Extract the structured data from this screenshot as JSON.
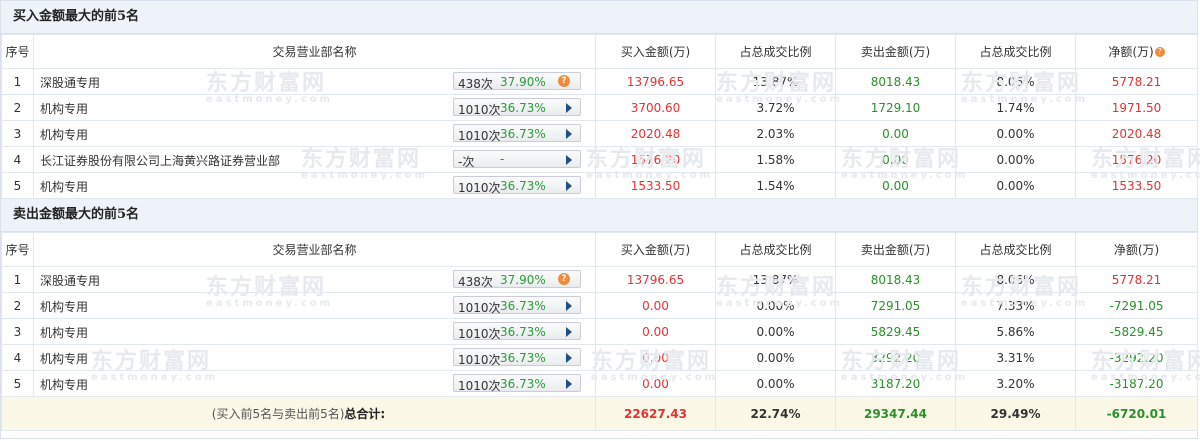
{
  "watermark": {
    "cn": "东方财富网",
    "en": "eastmoney.com"
  },
  "buy_section": {
    "title": "买入金额最大的前5名",
    "headers": {
      "no": "序号",
      "name": "交易营业部名称",
      "buy": "买入金额(万)",
      "buy_ratio": "占总成交比例",
      "sell": "卖出金额(万)",
      "sell_ratio": "占总成交比例",
      "net": "净额(万)"
    },
    "rows": [
      {
        "no": "1",
        "name": "深股通专用",
        "count": "438次",
        "rate": "37.90%",
        "buy": "13796.65",
        "buy_ratio": "13.87%",
        "sell": "8018.43",
        "sell_ratio": "8.06%",
        "net": "5778.21",
        "icon": "question-icon"
      },
      {
        "no": "2",
        "name": "机构专用",
        "count": "1010次",
        "rate": "36.73%",
        "buy": "3700.60",
        "buy_ratio": "3.72%",
        "sell": "1729.10",
        "sell_ratio": "1.74%",
        "net": "1971.50",
        "icon": "arrow-icon"
      },
      {
        "no": "3",
        "name": "机构专用",
        "count": "1010次",
        "rate": "36.73%",
        "buy": "2020.48",
        "buy_ratio": "2.03%",
        "sell": "0.00",
        "sell_ratio": "0.00%",
        "net": "2020.48",
        "icon": "arrow-icon"
      },
      {
        "no": "4",
        "name": "长江证券股份有限公司上海黄兴路证券营业部",
        "count": "-次",
        "rate": "-",
        "buy": "1576.20",
        "buy_ratio": "1.58%",
        "sell": "0.00",
        "sell_ratio": "0.00%",
        "net": "1576.20",
        "icon": "arrow-icon"
      },
      {
        "no": "5",
        "name": "机构专用",
        "count": "1010次",
        "rate": "36.73%",
        "buy": "1533.50",
        "buy_ratio": "1.54%",
        "sell": "0.00",
        "sell_ratio": "0.00%",
        "net": "1533.50",
        "icon": "arrow-icon"
      }
    ]
  },
  "sell_section": {
    "title": "卖出金额最大的前5名",
    "headers": {
      "no": "序号",
      "name": "交易营业部名称",
      "buy": "买入金额(万)",
      "buy_ratio": "占总成交比例",
      "sell": "卖出金额(万)",
      "sell_ratio": "占总成交比例",
      "net": "净额(万)"
    },
    "rows": [
      {
        "no": "1",
        "name": "深股通专用",
        "count": "438次",
        "rate": "37.90%",
        "buy": "13796.65",
        "buy_ratio": "13.87%",
        "sell": "8018.43",
        "sell_ratio": "8.06%",
        "net": "5778.21",
        "icon": "question-icon"
      },
      {
        "no": "2",
        "name": "机构专用",
        "count": "1010次",
        "rate": "36.73%",
        "buy": "0.00",
        "buy_ratio": "0.00%",
        "sell": "7291.05",
        "sell_ratio": "7.33%",
        "net": "-7291.05",
        "icon": "arrow-icon"
      },
      {
        "no": "3",
        "name": "机构专用",
        "count": "1010次",
        "rate": "36.73%",
        "buy": "0.00",
        "buy_ratio": "0.00%",
        "sell": "5829.45",
        "sell_ratio": "5.86%",
        "net": "-5829.45",
        "icon": "arrow-icon"
      },
      {
        "no": "4",
        "name": "机构专用",
        "count": "1010次",
        "rate": "36.73%",
        "buy": "0.00",
        "buy_ratio": "0.00%",
        "sell": "3292.20",
        "sell_ratio": "3.31%",
        "net": "-3292.20",
        "icon": "arrow-icon"
      },
      {
        "no": "5",
        "name": "机构专用",
        "count": "1010次",
        "rate": "36.73%",
        "buy": "0.00",
        "buy_ratio": "0.00%",
        "sell": "3187.20",
        "sell_ratio": "3.20%",
        "net": "-3187.20",
        "icon": "arrow-icon"
      }
    ]
  },
  "total": {
    "label_prefix": "(买入前5名与卖出前5名)",
    "label_bold": "总合计:",
    "buy": "22627.43",
    "buy_ratio": "22.74%",
    "sell": "29347.44",
    "sell_ratio": "29.49%",
    "net": "-6720.01"
  },
  "colors": {
    "red": "#e23333",
    "green": "#2b8f2b",
    "rate_green": "#2e9a3b",
    "header_bg": "#eef3fa",
    "total_bg": "#fbf8e8",
    "icon_orange": "#f08a3c",
    "arrow_blue": "#1f4f86"
  }
}
